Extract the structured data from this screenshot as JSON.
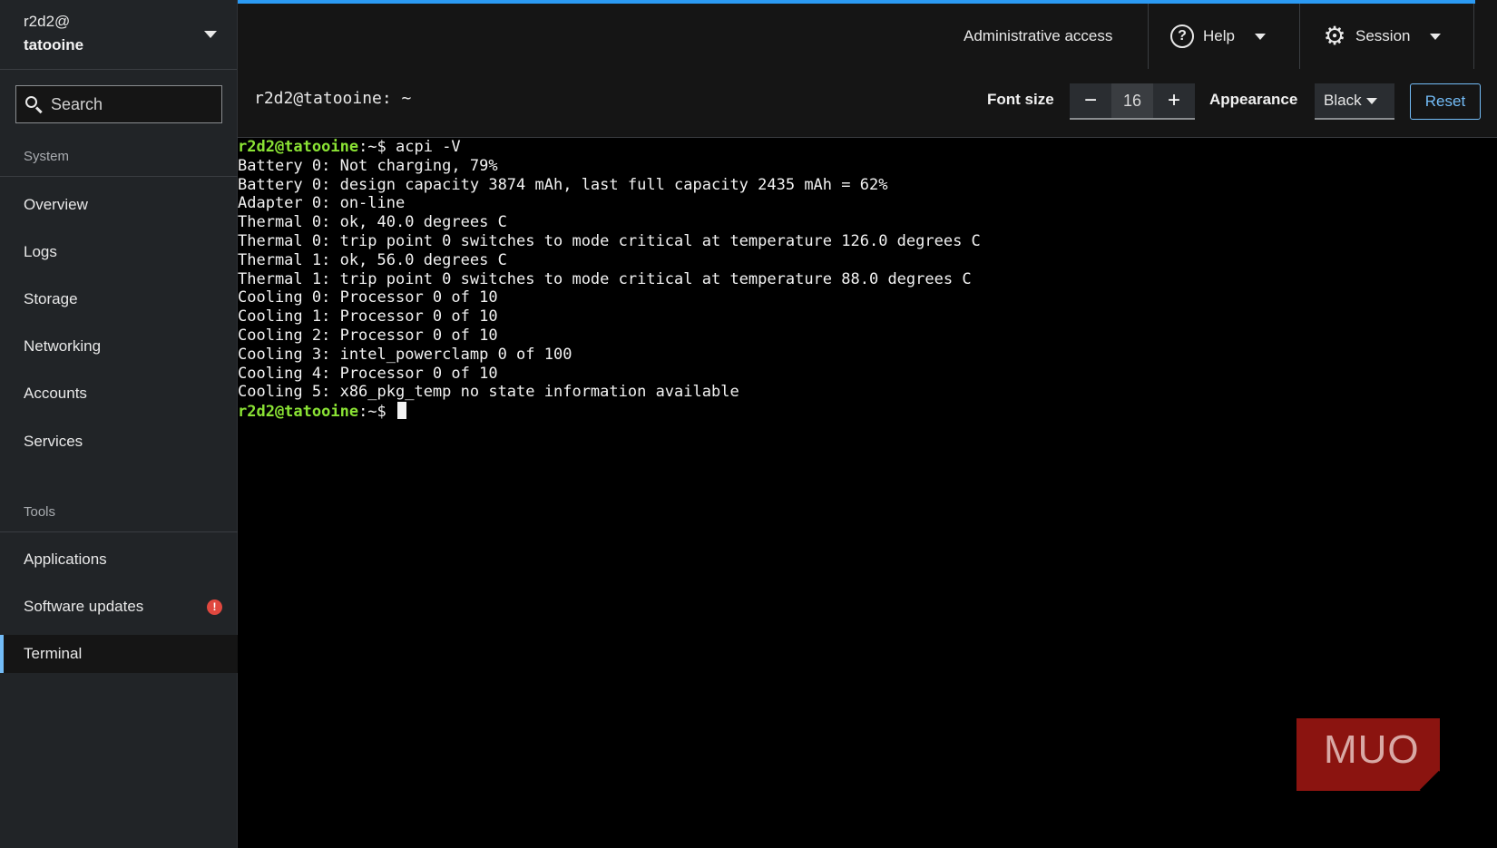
{
  "host": {
    "user": "r2d2@",
    "name": "tatooine"
  },
  "search": {
    "placeholder": "Search"
  },
  "sidebar": {
    "system_label": "System",
    "tools_label": "Tools",
    "system_items": [
      {
        "label": "Overview"
      },
      {
        "label": "Logs"
      },
      {
        "label": "Storage"
      },
      {
        "label": "Networking"
      },
      {
        "label": "Accounts"
      },
      {
        "label": "Services"
      }
    ],
    "tools_items": [
      {
        "label": "Applications"
      },
      {
        "label": "Software updates",
        "badge": "!"
      },
      {
        "label": "Terminal",
        "active": true
      }
    ]
  },
  "topbar": {
    "admin": "Administrative access",
    "help": "Help",
    "session": "Session"
  },
  "terminal_header": {
    "title": "r2d2@tatooine: ~",
    "font_size_label": "Font size",
    "font_minus": "−",
    "font_size_value": "16",
    "font_plus": "+",
    "appearance_label": "Appearance",
    "appearance_value": "Black",
    "reset_label": "Reset"
  },
  "terminal": {
    "prompt_user": "r2d2@tatooine",
    "prompt_suffix": ":~$ ",
    "command": "acpi -V",
    "output": [
      "Battery 0: Not charging, 79%",
      "Battery 0: design capacity 3874 mAh, last full capacity 2435 mAh = 62%",
      "Adapter 0: on-line",
      "Thermal 0: ok, 40.0 degrees C",
      "Thermal 0: trip point 0 switches to mode critical at temperature 126.0 degrees C",
      "Thermal 1: ok, 56.0 degrees C",
      "Thermal 1: trip point 0 switches to mode critical at temperature 88.0 degrees C",
      "Cooling 0: Processor 0 of 10",
      "Cooling 1: Processor 0 of 10",
      "Cooling 2: Processor 0 of 10",
      "Cooling 3: intel_powerclamp 0 of 100",
      "Cooling 4: Processor 0 of 10",
      "Cooling 5: x86_pkg_temp no state information available"
    ]
  },
  "watermark": {
    "text": "MUO"
  },
  "colors": {
    "accent": "#73bcf7",
    "prompt": "#8ae234",
    "badge": "#e0483f",
    "topline": "#2b9af3"
  }
}
